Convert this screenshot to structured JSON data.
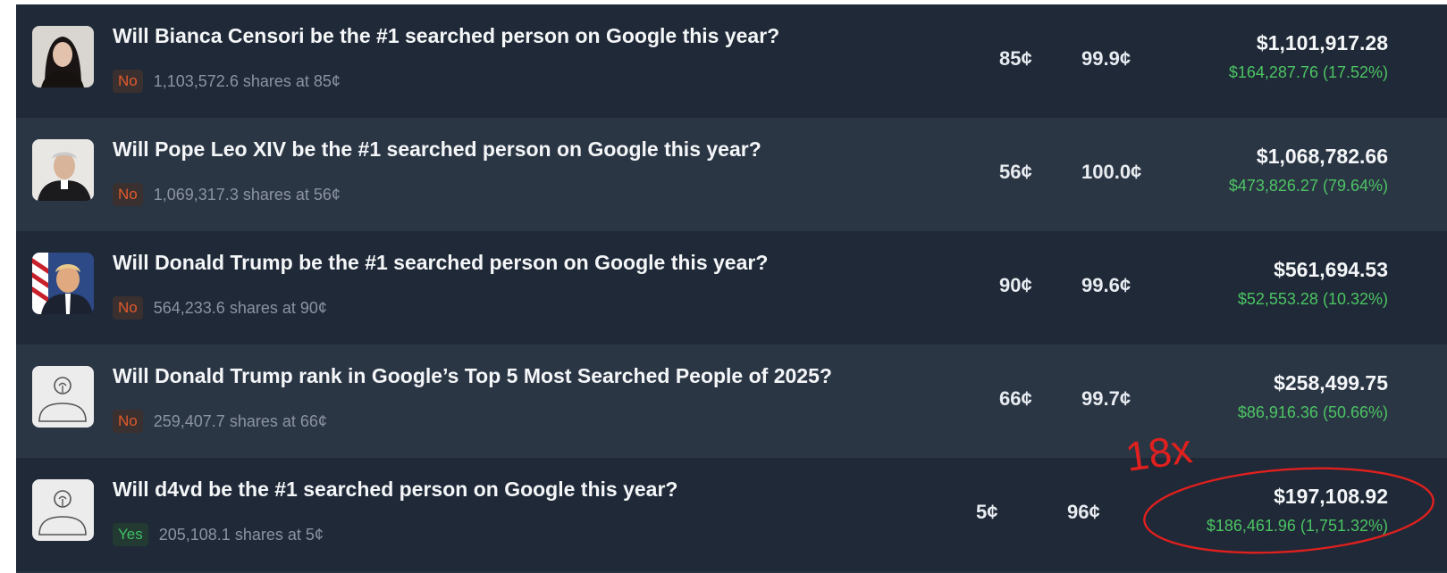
{
  "positions": [
    {
      "title": "Will Bianca Censori be the #1 searched person on Google this year?",
      "outcome": "No",
      "shares": "1,103,572.6 shares at 85¢",
      "avg_price": "85¢",
      "current_price": "99.9¢",
      "value": "$1,101,917.28",
      "pnl": "$164,287.76 (17.52%)",
      "avatar_icon": "bianca-censori-photo-icon"
    },
    {
      "title": "Will Pope Leo XIV be the #1 searched person on Google this year?",
      "outcome": "No",
      "shares": "1,069,317.3 shares at 56¢",
      "avg_price": "56¢",
      "current_price": "100.0¢",
      "value": "$1,068,782.66",
      "pnl": "$473,826.27 (79.64%)",
      "avatar_icon": "pope-leo-photo-icon"
    },
    {
      "title": "Will Donald Trump be the #1 searched person on Google this year?",
      "outcome": "No",
      "shares": "564,233.6 shares at 90¢",
      "avg_price": "90¢",
      "current_price": "99.6¢",
      "value": "$561,694.53",
      "pnl": "$52,553.28 (10.32%)",
      "avatar_icon": "donald-trump-photo-icon"
    },
    {
      "title": "Will Donald Trump rank in Google’s Top 5 Most Searched People of 2025?",
      "outcome": "No",
      "shares": "259,407.7 shares at 66¢",
      "avg_price": "66¢",
      "current_price": "99.7¢",
      "value": "$258,499.75",
      "pnl": "$86,916.36 (50.66%)",
      "avatar_icon": "placeholder-person-icon"
    },
    {
      "title": "Will d4vd be the #1 searched person on Google this year?",
      "outcome": "Yes",
      "shares": "205,108.1 shares at 5¢",
      "avg_price": "5¢",
      "current_price": "96¢",
      "value": "$197,108.92",
      "pnl": "$186,461.96 (1,751.32%)",
      "avatar_icon": "placeholder-person-icon"
    }
  ],
  "annotation": {
    "text": "18x",
    "color": "#e0201e"
  },
  "colors": {
    "no": "#e15a2c",
    "yes": "#3fbf63",
    "profit": "#4cc463"
  }
}
